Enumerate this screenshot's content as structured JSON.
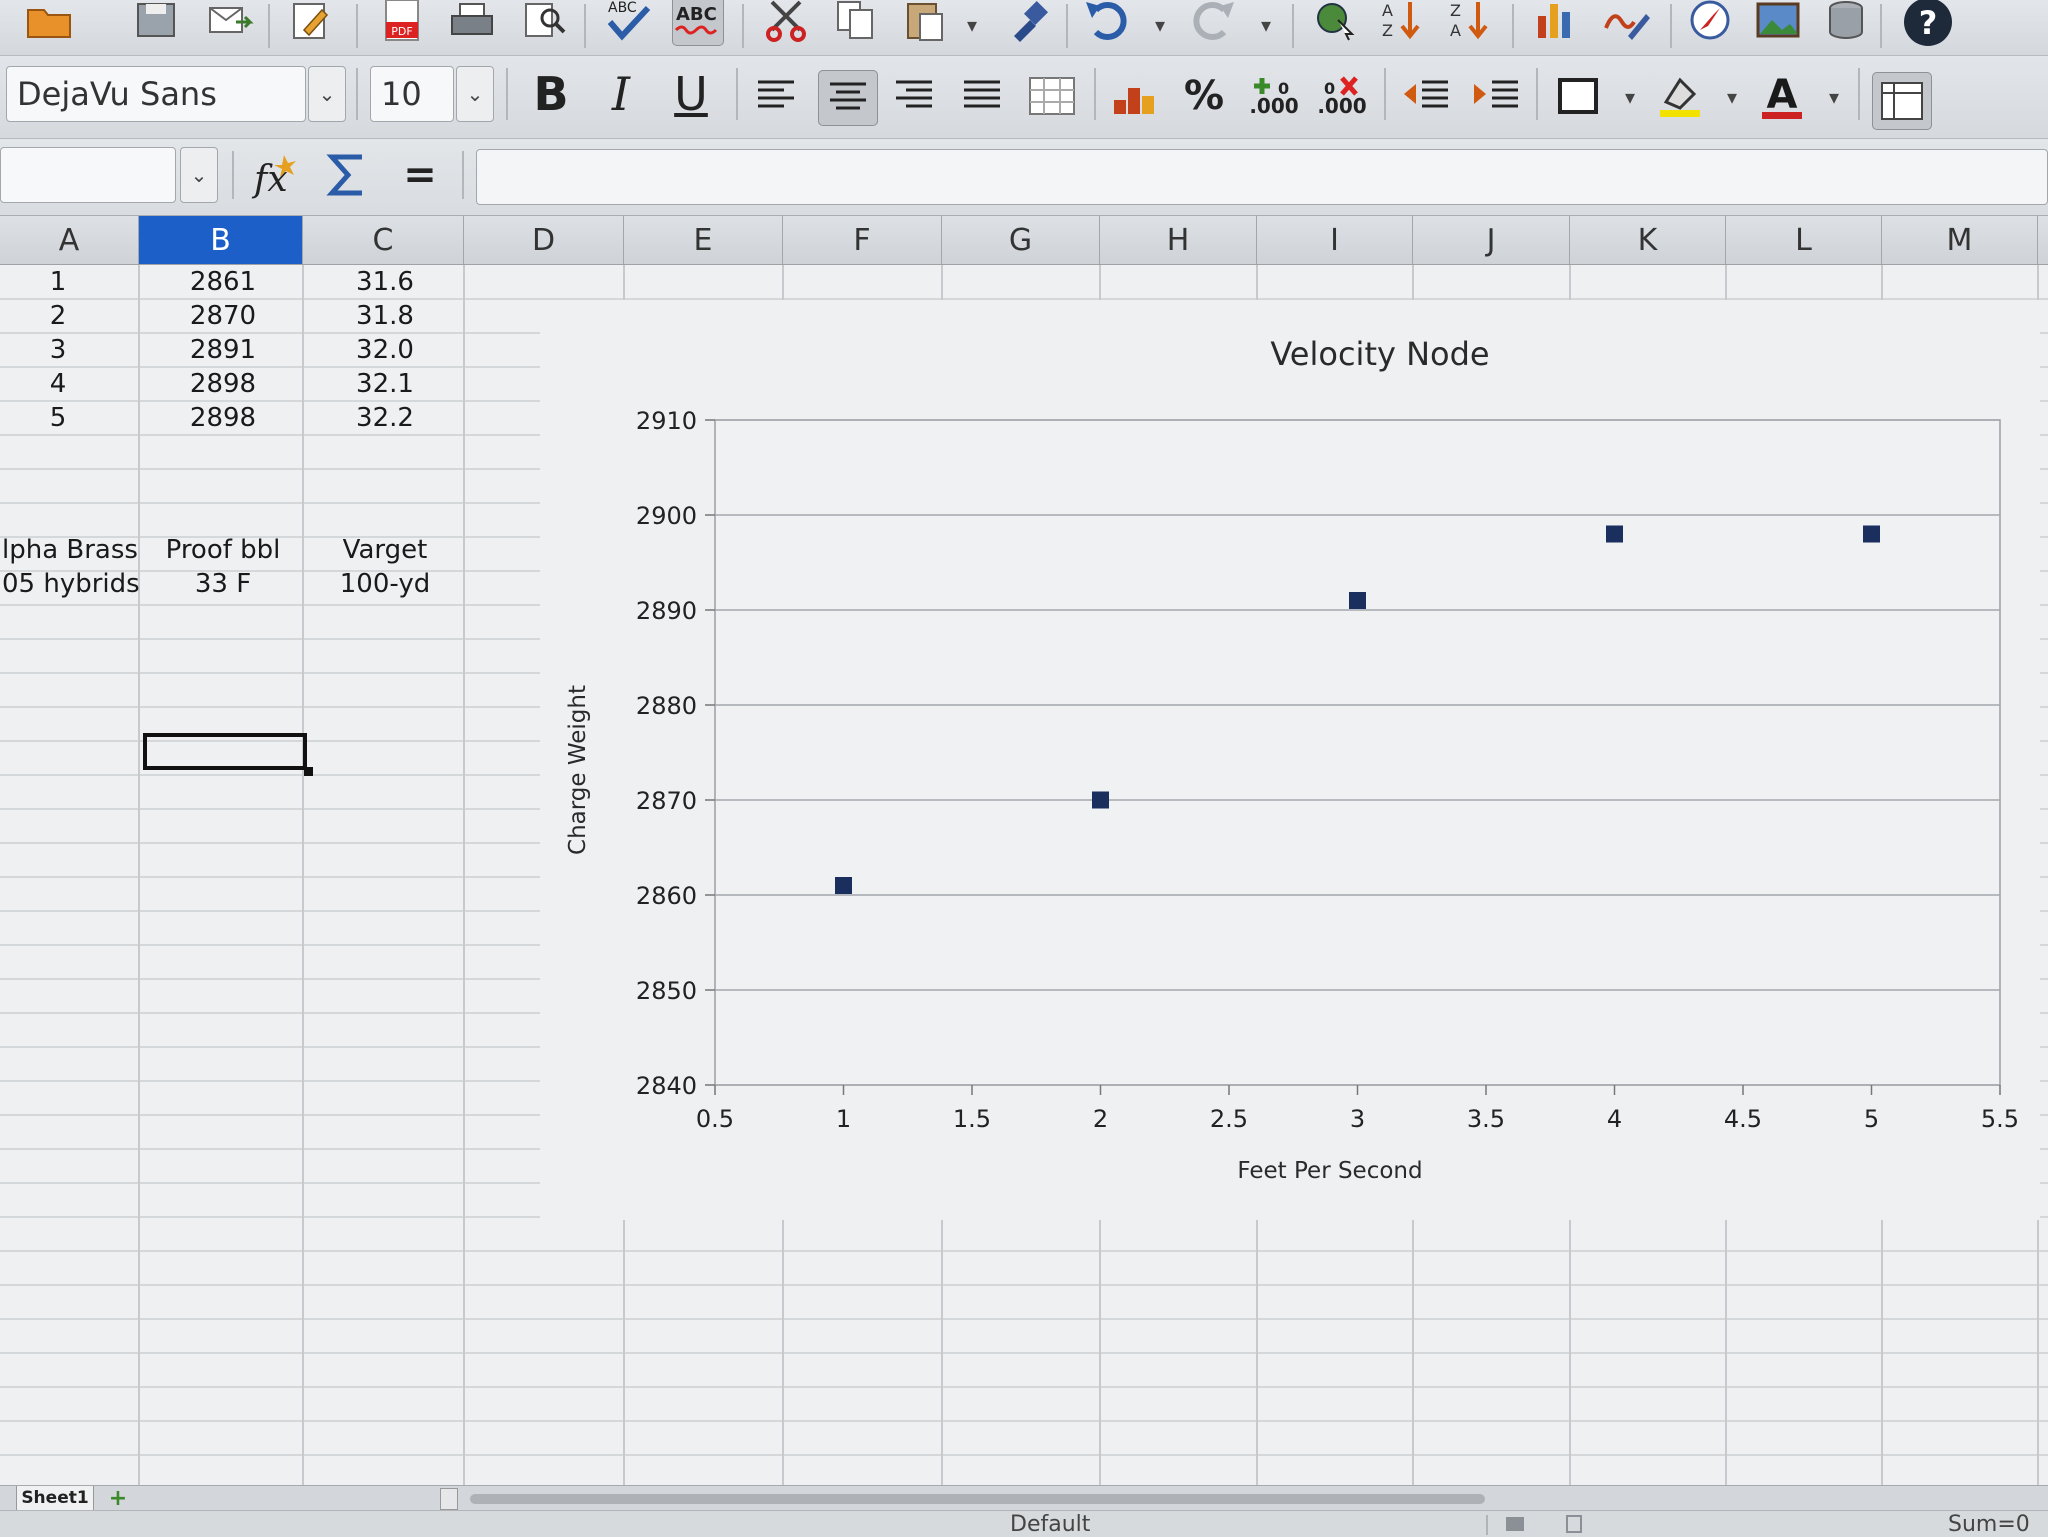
{
  "toolbar_format": {
    "font_name": "DejaVu Sans",
    "font_size": "10",
    "bold_label": "B",
    "italic_label": "I",
    "underline_label": "U",
    "percent_label": "%",
    "add_decimal_label": ".000",
    "delete_decimal_label": ".000"
  },
  "standard_toolbar": {
    "spellcheck_label": "ABC",
    "autospell_label": "ABC",
    "pdf_label": "PDF"
  },
  "formula_bar": {
    "name_box_value": "",
    "equals_label": "=",
    "input_value": ""
  },
  "columns": [
    "A",
    "B",
    "C",
    "D",
    "E",
    "F",
    "G",
    "H",
    "I",
    "J",
    "K",
    "L",
    "M"
  ],
  "selected_column": "B",
  "cells": {
    "r1": {
      "a": "1",
      "b": "2861",
      "c": "31.6"
    },
    "r2": {
      "a": "2",
      "b": "2870",
      "c": "31.8"
    },
    "r3": {
      "a": "3",
      "b": "2891",
      "c": "32.0"
    },
    "r4": {
      "a": "4",
      "b": "2898",
      "c": "32.1"
    },
    "r5": {
      "a": "5",
      "b": "2898",
      "c": "32.2"
    },
    "r8": {
      "a": "lpha Brass",
      "b": "Proof bbl",
      "c": "Varget"
    },
    "r9": {
      "a": "05 hybrids",
      "b": "33 F",
      "c": "100-yd"
    }
  },
  "chart_data": {
    "type": "scatter",
    "title": "Velocity Node",
    "xlabel": "Feet Per Second",
    "ylabel": "Charge Weight",
    "x": [
      1,
      2,
      3,
      4,
      5
    ],
    "y": [
      2861,
      2870,
      2891,
      2898,
      2898
    ],
    "xlim": [
      0.5,
      5.5
    ],
    "ylim": [
      2840,
      2910
    ],
    "x_ticks": [
      "0.5",
      "1",
      "1.5",
      "2",
      "2.5",
      "3",
      "3.5",
      "4",
      "4.5",
      "5",
      "5.5"
    ],
    "y_ticks": [
      "2840",
      "2850",
      "2860",
      "2870",
      "2880",
      "2890",
      "2900",
      "2910"
    ],
    "grid": "horizontal",
    "legend": "none",
    "marker_color": "#1a2f5e"
  },
  "sheet_tab": {
    "label": "Sheet1"
  },
  "status": {
    "page_style": "Default",
    "sum": "Sum=0"
  },
  "colors": {
    "selection": "#1d5fc9",
    "accent": "#1a2f5e"
  }
}
